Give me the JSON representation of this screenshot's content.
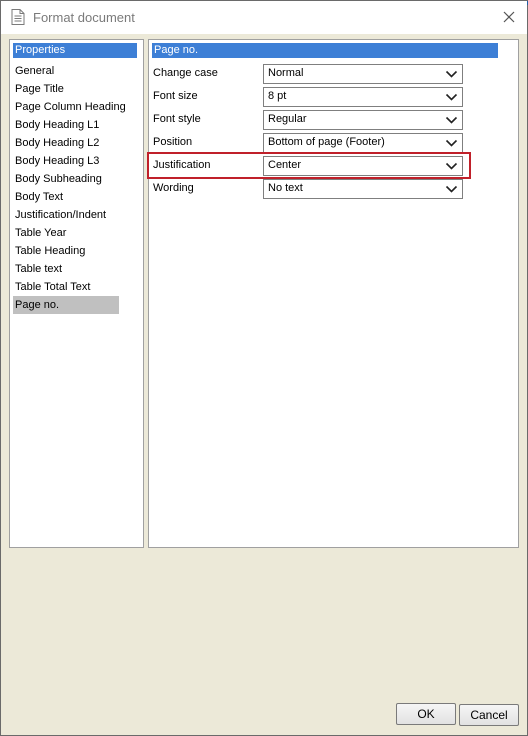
{
  "window": {
    "title": "Format document",
    "title_icon": "document-icon",
    "close_icon": "close-icon"
  },
  "properties_panel": {
    "header": "Properties",
    "items": [
      {
        "label": "General",
        "selected": false
      },
      {
        "label": "Page Title",
        "selected": false
      },
      {
        "label": "Page Column Heading",
        "selected": false
      },
      {
        "label": "Body Heading L1",
        "selected": false
      },
      {
        "label": "Body Heading L2",
        "selected": false
      },
      {
        "label": "Body Heading L3",
        "selected": false
      },
      {
        "label": "Body Subheading",
        "selected": false
      },
      {
        "label": "Body Text",
        "selected": false
      },
      {
        "label": "Justification/Indent",
        "selected": false
      },
      {
        "label": "Table Year",
        "selected": false
      },
      {
        "label": "Table Heading",
        "selected": false
      },
      {
        "label": "Table text",
        "selected": false
      },
      {
        "label": "Table Total Text",
        "selected": false
      },
      {
        "label": "Page no.",
        "selected": true
      }
    ]
  },
  "settings_panel": {
    "header": "Page no.",
    "rows": [
      {
        "label": "Change case",
        "value": "Normal"
      },
      {
        "label": "Font size",
        "value": "8 pt"
      },
      {
        "label": "Font style",
        "value": "Regular"
      },
      {
        "label": "Position",
        "value": "Bottom of page (Footer)"
      },
      {
        "label": "Justification",
        "value": "Center",
        "highlighted": true
      },
      {
        "label": "Wording",
        "value": "No text"
      }
    ]
  },
  "buttons": {
    "ok": "OK",
    "cancel": "Cancel"
  },
  "colors": {
    "header_bg": "#3d7fd6",
    "highlight_border": "#c0202a",
    "dialog_bg": "#ece9d8",
    "selected_item_bg": "#c0c0c0"
  }
}
